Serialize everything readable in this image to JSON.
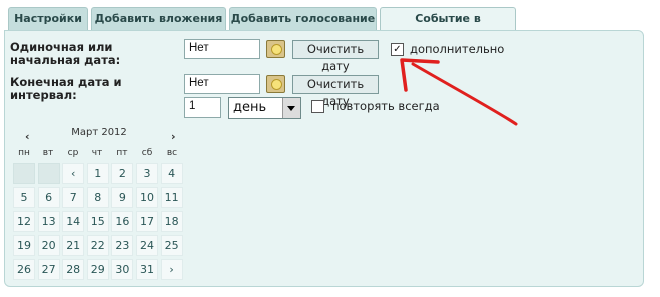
{
  "tabs": [
    "Настройки",
    "Добавить вложения",
    "Добавить голосование",
    "Событие в календаре"
  ],
  "form": {
    "start_label_1": "Одиночная или",
    "start_label_2": "начальная дата:",
    "start_value": "Нет",
    "clear_label": "Очистить дату",
    "extra_label": "дополнительно",
    "extra_checked": "✓",
    "end_label_1": "Конечная дата и",
    "end_label_2": "интервал:",
    "end_value": "Нет",
    "interval_value": "1",
    "interval_unit": "день",
    "repeat_label": "повторять всегда"
  },
  "calendar": {
    "prev": "‹",
    "next": "›",
    "month": "Март 2012",
    "weekdays": [
      "пн",
      "вт",
      "ср",
      "чт",
      "пт",
      "сб",
      "вс"
    ],
    "rows": [
      [
        "",
        "",
        "‹",
        "1",
        "2",
        "3",
        "4"
      ],
      [
        "5",
        "6",
        "7",
        "8",
        "9",
        "10",
        "11"
      ],
      [
        "12",
        "13",
        "14",
        "15",
        "16",
        "17",
        "18"
      ],
      [
        "19",
        "20",
        "21",
        "22",
        "23",
        "24",
        "25"
      ],
      [
        "26",
        "27",
        "28",
        "29",
        "30",
        "31",
        "›"
      ]
    ]
  },
  "colors": {
    "panel": "#e8f4f3",
    "tab": "#c5dedd",
    "annotation_arrow": "#e0201e"
  }
}
